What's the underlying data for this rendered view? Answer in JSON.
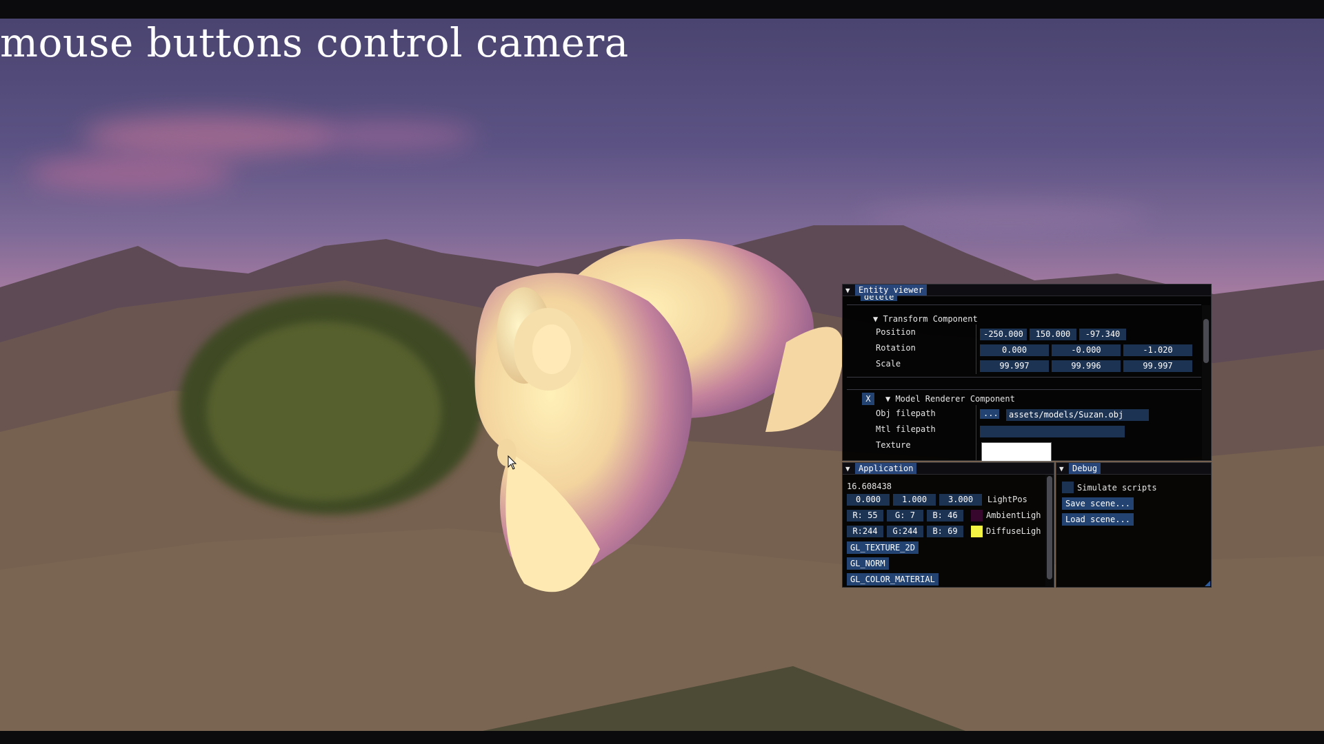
{
  "overlay_hint": "mouse buttons control camera",
  "entity_viewer": {
    "title": "Entity viewer",
    "cut_label": "delete",
    "transform": {
      "header": "Transform Component",
      "rows": [
        {
          "label": "Position",
          "values": [
            "-250.000",
            "150.000",
            "-97.340"
          ]
        },
        {
          "label": "Rotation",
          "values": [
            "0.000",
            "-0.000",
            "-1.020"
          ]
        },
        {
          "label": "Scale",
          "values": [
            "99.997",
            "99.996",
            "99.997"
          ]
        }
      ]
    },
    "model_renderer": {
      "remove_label": "X",
      "header": "Model Renderer Component",
      "obj_label": "Obj filepath",
      "browse_label": "...",
      "obj_value": "assets/models/Suzan.obj",
      "mtl_label": "Mtl filepath",
      "mtl_value": "",
      "texture_label": "Texture"
    }
  },
  "application": {
    "title": "Application",
    "frame_time": "16.608438",
    "light_pos": {
      "values": [
        "0.000",
        "1.000",
        "3.000"
      ],
      "label": "LightPos"
    },
    "ambient": {
      "values": [
        "R: 55",
        "G: 7",
        "B: 46"
      ],
      "label": "AmbientLigh",
      "color": "#37072e"
    },
    "diffuse": {
      "values": [
        "R:244",
        "G:244",
        "B: 69"
      ],
      "label": "DiffuseLigh",
      "color": "#f4f445"
    },
    "toggles": [
      "GL_TEXTURE_2D",
      "GL_NORM",
      "GL_COLOR_MATERIAL"
    ]
  },
  "debug": {
    "title": "Debug",
    "simulate_label": "Simulate scripts",
    "save_label": "Save scene...",
    "load_label": "Load scene..."
  },
  "colors": {
    "title_active": "#29467a",
    "field_bg": "#1d3354",
    "button_bg": "#234473"
  }
}
